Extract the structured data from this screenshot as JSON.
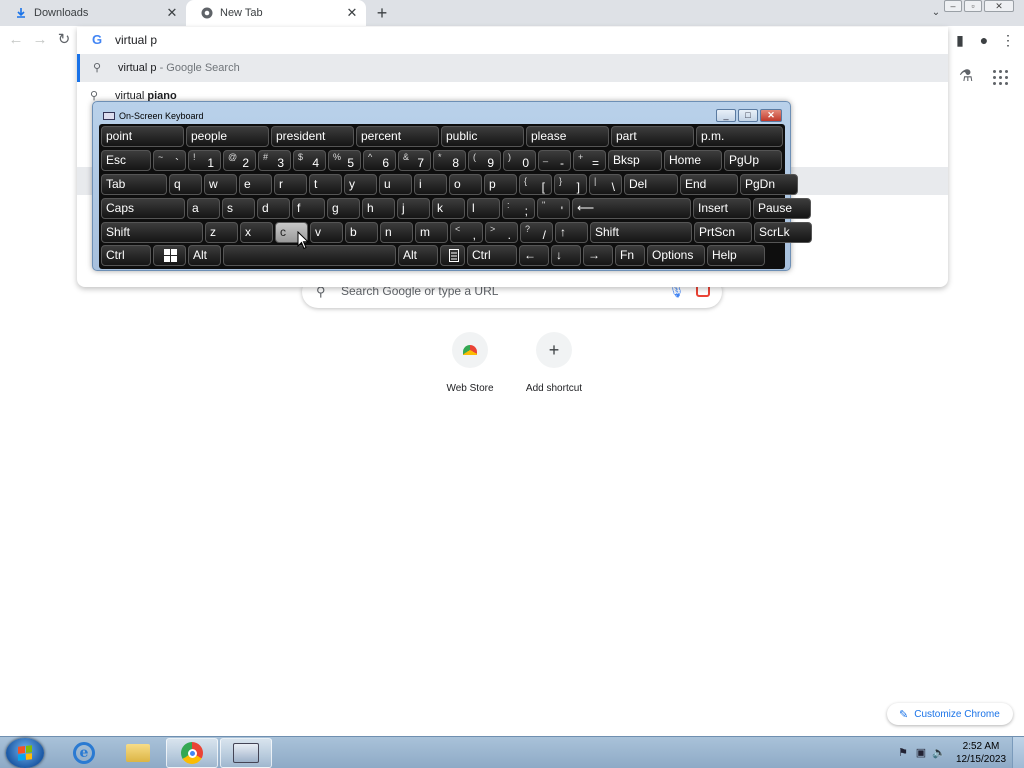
{
  "tabs": [
    {
      "title": "Downloads",
      "icon": "download-icon"
    },
    {
      "title": "New Tab",
      "icon": "chrome-icon"
    }
  ],
  "omnibox": {
    "query": "virtual p",
    "suggestions": [
      {
        "main": "virtual p",
        "suffix": " - Google Search"
      },
      {
        "prefix": "virtual ",
        "bold": "piano"
      }
    ]
  },
  "ntp": {
    "search_placeholder": "Search Google or type a URL",
    "shortcuts": [
      {
        "label": "Web Store"
      },
      {
        "label": "Add shortcut"
      }
    ],
    "customize_label": "Customize Chrome"
  },
  "osk": {
    "title": "On-Screen Keyboard",
    "predictions": [
      "point",
      "people",
      "president",
      "percent",
      "public",
      "please",
      "part",
      "p.m."
    ],
    "row1": [
      {
        "label": "Esc"
      },
      {
        "top": "~",
        "bot": "`"
      },
      {
        "top": "!",
        "bot": "1"
      },
      {
        "top": "@",
        "bot": "2"
      },
      {
        "top": "#",
        "bot": "3"
      },
      {
        "top": "$",
        "bot": "4"
      },
      {
        "top": "%",
        "bot": "5"
      },
      {
        "top": "^",
        "bot": "6"
      },
      {
        "top": "&",
        "bot": "7"
      },
      {
        "top": "*",
        "bot": "8"
      },
      {
        "top": "(",
        "bot": "9"
      },
      {
        "top": ")",
        "bot": "0"
      },
      {
        "top": "_",
        "bot": "-"
      },
      {
        "top": "+",
        "bot": "="
      },
      {
        "label": "Bksp"
      },
      {
        "label": "Home"
      },
      {
        "label": "PgUp"
      }
    ],
    "row2": [
      {
        "label": "Tab"
      },
      {
        "label": "q"
      },
      {
        "label": "w"
      },
      {
        "label": "e"
      },
      {
        "label": "r"
      },
      {
        "label": "t"
      },
      {
        "label": "y"
      },
      {
        "label": "u"
      },
      {
        "label": "i"
      },
      {
        "label": "o"
      },
      {
        "label": "p"
      },
      {
        "top": "{",
        "bot": "["
      },
      {
        "top": "}",
        "bot": "]"
      },
      {
        "top": "|",
        "bot": "\\"
      },
      {
        "label": "Del"
      },
      {
        "label": "End"
      },
      {
        "label": "PgDn"
      }
    ],
    "row3": [
      {
        "label": "Caps"
      },
      {
        "label": "a"
      },
      {
        "label": "s"
      },
      {
        "label": "d"
      },
      {
        "label": "f"
      },
      {
        "label": "g"
      },
      {
        "label": "h"
      },
      {
        "label": "j"
      },
      {
        "label": "k"
      },
      {
        "label": "l"
      },
      {
        "top": ":",
        "bot": ";"
      },
      {
        "top": "\"",
        "bot": "'"
      },
      {
        "label": "⟵"
      },
      {
        "label": "Insert"
      },
      {
        "label": "Pause"
      }
    ],
    "row4": [
      {
        "label": "Shift"
      },
      {
        "label": "z"
      },
      {
        "label": "x"
      },
      {
        "label": "c"
      },
      {
        "label": "v"
      },
      {
        "label": "b"
      },
      {
        "label": "n"
      },
      {
        "label": "m"
      },
      {
        "top": "<",
        "bot": ","
      },
      {
        "top": ">",
        "bot": "."
      },
      {
        "top": "?",
        "bot": "/"
      },
      {
        "label": "↑"
      },
      {
        "label": "Shift"
      },
      {
        "label": "PrtScn"
      },
      {
        "label": "ScrLk"
      }
    ],
    "row5": [
      {
        "label": "Ctrl"
      },
      {
        "label": "win"
      },
      {
        "label": "Alt"
      },
      {
        "label": ""
      },
      {
        "label": "Alt"
      },
      {
        "label": "menu"
      },
      {
        "label": "Ctrl"
      },
      {
        "label": "←"
      },
      {
        "label": "↓"
      },
      {
        "label": "→"
      },
      {
        "label": "Fn"
      },
      {
        "label": "Options"
      },
      {
        "label": "Help"
      }
    ],
    "pressed_key": "c"
  },
  "taskbar": {
    "time": "2:52 AM",
    "date": "12/15/2023"
  },
  "colors": {
    "accent": "#1a73e8",
    "tabstrip": "#dee1e6"
  }
}
